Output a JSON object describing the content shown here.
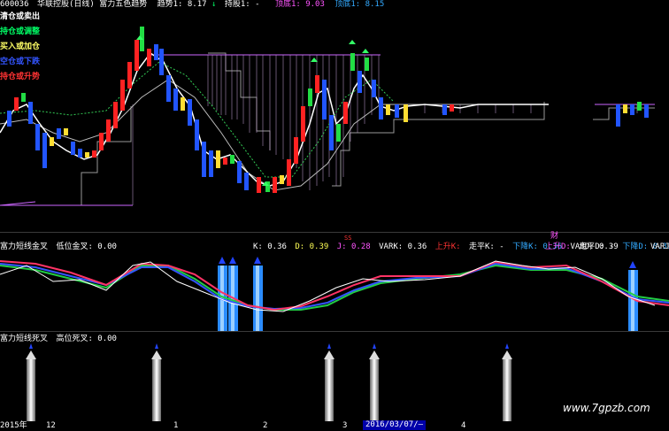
{
  "top_header": {
    "code": "600036",
    "title": "华联控股(日线) 富力五色趋势",
    "trend1_label": "趋势1:",
    "trend1_value": "8.17",
    "trend_down_arrow": "↓",
    "support_label": "持股1:",
    "support_value": "-",
    "top_label": "顶底1:",
    "top_value": "9.03",
    "bottom_label": "顶底1:",
    "bottom_value": "8.15"
  },
  "legend": [
    {
      "text": "清仓或卖出",
      "color": "#ffffff"
    },
    {
      "text": "持仓或调整",
      "color": "#00ff66"
    },
    {
      "text": "买入或加仓",
      "color": "#ffff66"
    },
    {
      "text": "空仓或下跌",
      "color": "#3355ff"
    },
    {
      "text": "持仓或升势",
      "color": "#ff3333"
    }
  ],
  "middle_header": {
    "name": "富力短线金叉",
    "label": "低位金叉:",
    "value": "0.00",
    "k_label": "K:",
    "k_value": "0.36",
    "d_label": "D:",
    "d_value": "0.39",
    "j_label": "J:",
    "j_value": "0.28",
    "vark_label": "VARK:",
    "vark_value": "0.36",
    "up_k": "上升K:",
    "flat_k": "走平K:",
    "flat_k_value": "-",
    "down_k": "下降K:",
    "down_k_value": "0.36",
    "vard_label": "VARD:",
    "vard_value": "0.39",
    "up_d": "上升D:",
    "flat_d": "走平D:",
    "flat_d_value": "-",
    "down_d": "下降D:",
    "down_d_value": "0.39",
    "varj": "VARJ",
    "ss_mark": "SS",
    "cai_mark": "财"
  },
  "bottom_header": {
    "name": "富力短线死叉",
    "label": "高位死叉:",
    "value": "0.00"
  },
  "x_axis": {
    "labels": [
      "2015年",
      "12",
      "1",
      "2",
      "3",
      "2016/03/07/—",
      "4"
    ]
  },
  "watermark": "www.7gpzb.com",
  "colors": {
    "up_candle": "#ff2222",
    "down_candle": "#2255ff",
    "yellow_candle": "#ffdd33",
    "green_candle": "#22dd44",
    "white_line": "#ffffff",
    "purple_line": "#cc66ff",
    "gray_line": "#aaaaaa",
    "blue_bar": "#2a8cff"
  }
}
